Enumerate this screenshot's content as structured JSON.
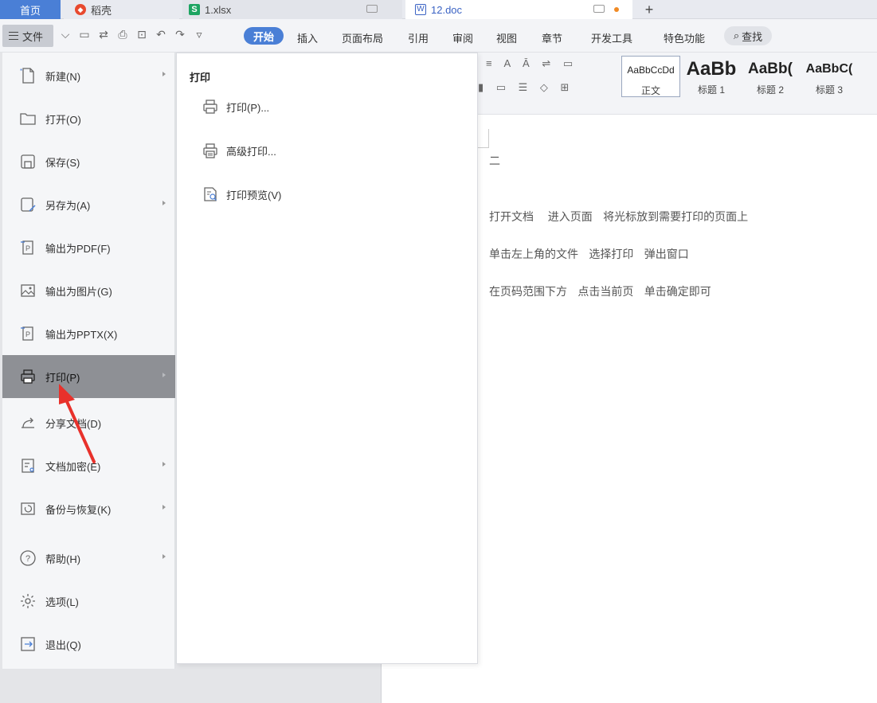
{
  "tabs": {
    "home": "首页",
    "daoke": "稻壳",
    "xlsx": "1.xlsx",
    "doc": "12.doc",
    "add": "+"
  },
  "ribbon": {
    "file_label": "文件",
    "tabs": [
      "开始",
      "插入",
      "页面布局",
      "引用",
      "审阅",
      "视图",
      "章节",
      "开发工具",
      "特色功能"
    ],
    "active_tab": "开始",
    "search": "查找"
  },
  "styles": {
    "normal_preview": "AaBbCcDd",
    "normal_label": "正文",
    "h1_preview": "AaBb",
    "h1_label": "标题 1",
    "h2_preview": "AaBb(",
    "h2_label": "标题 2",
    "h3_preview": "AaBbC(",
    "h3_label": "标题 3"
  },
  "file_menu": {
    "items": [
      {
        "label": "新建(N)",
        "icon": "new-file-icon",
        "has_submenu": true
      },
      {
        "label": "打开(O)",
        "icon": "folder-icon",
        "has_submenu": false
      },
      {
        "label": "保存(S)",
        "icon": "save-icon",
        "has_submenu": false
      },
      {
        "label": "另存为(A)",
        "icon": "save-as-icon",
        "has_submenu": true
      },
      {
        "label": "输出为PDF(F)",
        "icon": "export-pdf-icon",
        "has_submenu": false
      },
      {
        "label": "输出为图片(G)",
        "icon": "export-image-icon",
        "has_submenu": false
      },
      {
        "label": "输出为PPTX(X)",
        "icon": "export-pptx-icon",
        "has_submenu": false
      },
      {
        "label": "打印(P)",
        "icon": "printer-icon",
        "has_submenu": true,
        "active": true
      },
      {
        "label": "分享文档(D)",
        "icon": "share-icon",
        "has_submenu": false
      },
      {
        "label": "文档加密(E)",
        "icon": "encrypt-icon",
        "has_submenu": true
      },
      {
        "label": "备份与恢复(K)",
        "icon": "backup-icon",
        "has_submenu": true
      },
      {
        "label": "帮助(H)",
        "icon": "help-icon",
        "has_submenu": true
      },
      {
        "label": "选项(L)",
        "icon": "gear-icon",
        "has_submenu": false
      },
      {
        "label": "退出(Q)",
        "icon": "exit-icon",
        "has_submenu": false
      }
    ]
  },
  "print_submenu": {
    "title": "打印",
    "items": [
      {
        "label": "打印(P)...",
        "icon": "printer-icon"
      },
      {
        "label": "高级打印...",
        "icon": "advanced-print-icon"
      },
      {
        "label": "打印预览(V)",
        "icon": "print-preview-icon"
      }
    ]
  },
  "document": {
    "heading": "二",
    "lines": [
      "打开文档    进入页面   将光标放到需要打印的页面上",
      "单击左上角的文件   选择打印   弹出窗口",
      "在页码范围下方   点击当前页   单击确定即可"
    ]
  },
  "colors": {
    "accent": "#4a7fd6",
    "annotation_arrow": "#e8312b"
  }
}
